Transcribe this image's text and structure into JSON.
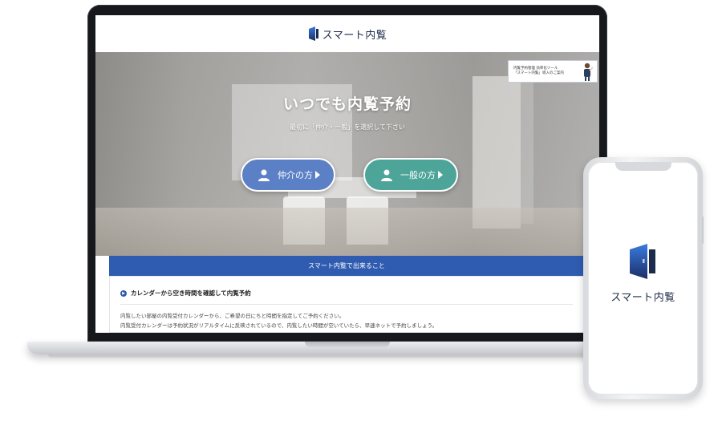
{
  "brand": {
    "name": "スマート内覧",
    "navy": "#1d2b4a",
    "blue": "#2f5cb0"
  },
  "hero": {
    "title": "いつでも内覧予約",
    "subtitle": "最初に「仲介・一般」を選択して下さい",
    "buttons": [
      {
        "label": "仲介の方",
        "color": "#5b80c6",
        "icon": "person-icon"
      },
      {
        "label": "一般の方",
        "color": "#4da59a",
        "icon": "person-icon"
      }
    ],
    "guide_banner": {
      "line1": "内覧予約管理 効率化ツール",
      "line2": "「スマート内覧」導入のご案内"
    }
  },
  "info": {
    "header": "スマート内覧で出来ること",
    "feature": {
      "title": "カレンダーから空き時間を確認して内覧予約",
      "desc1": "内覧したい部屋の内覧受付カレンダーから、ご希望の日にちと時間を指定してご予約ください。",
      "desc2": "内覧受付カレンダーは予約状況がリアルタイムに反映されているので、内覧したい時間が空いていたら、早速ネットで予約しましょう。"
    }
  },
  "phone": {
    "logo_text": "スマート内覧"
  }
}
